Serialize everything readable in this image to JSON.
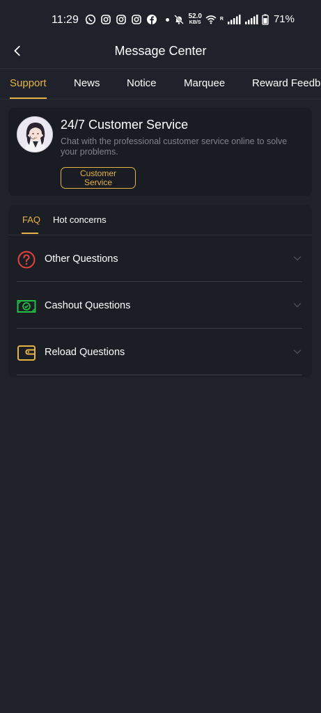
{
  "status_bar": {
    "time": "11:29",
    "net_speed_value": "52.0",
    "net_speed_unit": "KB/S",
    "roaming": "R",
    "battery": "71%",
    "icons": [
      "whatsapp-icon",
      "instagram-icon",
      "instagram-icon",
      "instagram-icon",
      "facebook-icon",
      "dot",
      "mute-icon",
      "wifi-icon",
      "signal-icon",
      "signal-icon",
      "battery-icon"
    ]
  },
  "header": {
    "title": "Message Center",
    "back_icon": "chevron-left-icon"
  },
  "tabs": [
    {
      "label": "Support",
      "active": true
    },
    {
      "label": "News",
      "active": false
    },
    {
      "label": "Notice",
      "active": false
    },
    {
      "label": "Marquee",
      "active": false
    },
    {
      "label": "Reward Feedb",
      "active": false
    }
  ],
  "customer_service": {
    "title": "24/7 Customer Service",
    "description": "Chat with the professional customer service online to solve your problems.",
    "button_line1": "Customer",
    "button_line2": "Service"
  },
  "faq": {
    "tabs": [
      {
        "label": "FAQ",
        "active": true
      },
      {
        "label": "Hot concerns",
        "active": false
      }
    ],
    "items": [
      {
        "label": "Other Questions",
        "icon": "question-circle-icon",
        "icon_color": "#e0443b"
      },
      {
        "label": "Cashout Questions",
        "icon": "cash-check-icon",
        "icon_color": "#22c043"
      },
      {
        "label": "Reload Questions",
        "icon": "wallet-icon",
        "icon_color": "#e6b445"
      }
    ]
  },
  "colors": {
    "background": "#1f222b",
    "accent": "#e6b445",
    "card": "#191c23",
    "muted_text": "#80838c"
  }
}
